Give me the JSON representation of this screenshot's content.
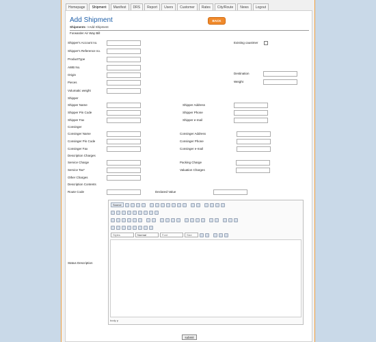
{
  "tabs": [
    "Homepage",
    "Shipment",
    "Manifest",
    "DRS",
    "Report",
    "Users",
    "Customer",
    "Rates",
    "City/Route",
    "News",
    "Logout"
  ],
  "active_tab": "Shipment",
  "header": {
    "title": "Add Shipment",
    "breadcrumb_root": "Shipments",
    "breadcrumb_sep": " ->",
    "breadcrumb_current": "Add Shipment",
    "back_label": "BACK",
    "awb_label": "Forwarder Air Way Bill"
  },
  "fields": {
    "shippers_account": "Shipper's Account no.",
    "existing_customer": "Existing caustmer",
    "shippers_reference": "Shipper's Reference no.",
    "product_type": "ProductType",
    "awb_no": "AWB No.",
    "origin": "Origin",
    "destination": "Destination",
    "pieces": "Pieces",
    "weight": "Weight",
    "volumetric_weight": "Volumatic weight",
    "shipper_section": "Shipper",
    "shipper_name": "Shipper Name",
    "shipper_address": "Shipper Address",
    "shipper_pin": "Shipper Pin Code",
    "shipper_phone": "Shipper Phone",
    "shipper_fax": "Shipper Fax",
    "shipper_email": "Shipper e-mail",
    "consignee_section": "Consinger",
    "consignee_name": "Consinger Name",
    "consignee_address": "Consinger Address",
    "consignee_pin": "Consinger Pin Code",
    "consignee_phone": "Consinger Phone",
    "consignee_fax": "Consinger Fax",
    "consignee_email": "Consinger e-mail",
    "description_charges": "Description Charges",
    "service_charge": "Service Charge",
    "packing_charge": "Packing Charge",
    "service_tax": "Service Tax*",
    "valuation_charges": "Valuation Charges",
    "other_charges": "Other Charges",
    "description_contents": "Description Contents",
    "route_code": "Route Code",
    "declared_value": "Declared Value",
    "status_description": "Status Description"
  },
  "editor": {
    "source_label": "Source",
    "style_placeholder": "Styles",
    "format_value": "Normal",
    "font_placeholder": "Font",
    "size_placeholder": "Size",
    "status": "body p"
  },
  "submit_label": "submit",
  "colors": {
    "accent": "#1f5fa8",
    "back_button": "#f08a2c",
    "frame": "#f0a040"
  }
}
